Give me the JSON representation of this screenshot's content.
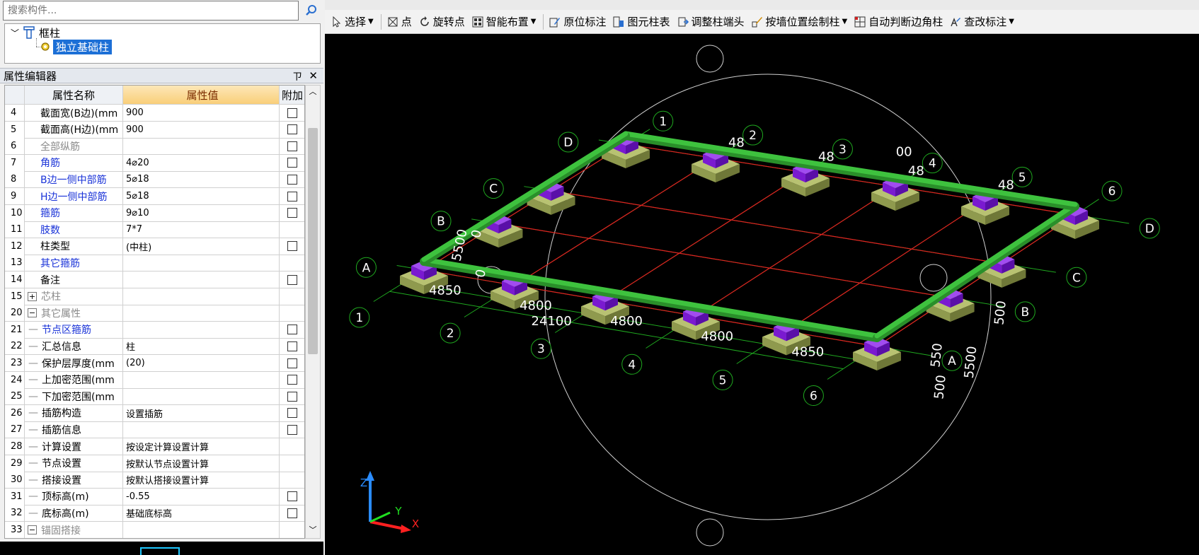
{
  "search": {
    "placeholder": "搜索构件..."
  },
  "tree": {
    "root": "框柱",
    "child": "独立基础柱"
  },
  "panel": {
    "title": "属性编辑器",
    "pin": "ㄗ",
    "close": "✕"
  },
  "grid": {
    "headers": {
      "name": "属性名称",
      "value": "属性值",
      "extra": "附加"
    },
    "rows": [
      {
        "num": "4",
        "name": "截面宽(B边)(mm",
        "value": "900",
        "check": true,
        "color": "black"
      },
      {
        "num": "5",
        "name": "截面高(H边)(mm",
        "value": "900",
        "check": true,
        "color": "black"
      },
      {
        "num": "6",
        "name": "全部纵筋",
        "value": "",
        "check": true,
        "color": "gray"
      },
      {
        "num": "7",
        "name": "角筋",
        "value": "4⌀20",
        "check": true,
        "color": "blue"
      },
      {
        "num": "8",
        "name": "B边一侧中部筋",
        "value": "5⌀18",
        "check": true,
        "color": "blue"
      },
      {
        "num": "9",
        "name": "H边一侧中部筋",
        "value": "5⌀18",
        "check": true,
        "color": "blue"
      },
      {
        "num": "10",
        "name": "箍筋",
        "value": "9⌀10",
        "check": true,
        "color": "blue"
      },
      {
        "num": "11",
        "name": "肢数",
        "value": "7*7",
        "check": false,
        "color": "blue"
      },
      {
        "num": "12",
        "name": "柱类型",
        "value": "(中柱)",
        "check": true,
        "color": "black"
      },
      {
        "num": "13",
        "name": "其它箍筋",
        "value": "",
        "check": false,
        "color": "blue"
      },
      {
        "num": "14",
        "name": "备注",
        "value": "",
        "check": true,
        "color": "black"
      },
      {
        "num": "15",
        "name": "芯柱",
        "value": "",
        "check": false,
        "color": "gray",
        "expander": "+"
      },
      {
        "num": "20",
        "name": "其它属性",
        "value": "",
        "check": false,
        "color": "gray",
        "expander": "−"
      },
      {
        "num": "21",
        "name": "节点区箍筋",
        "value": "",
        "check": true,
        "color": "blue",
        "child": true
      },
      {
        "num": "22",
        "name": "汇总信息",
        "value": "柱",
        "check": true,
        "color": "black",
        "child": true
      },
      {
        "num": "23",
        "name": "保护层厚度(mm",
        "value": "(20)",
        "check": true,
        "color": "black",
        "child": true
      },
      {
        "num": "24",
        "name": "上加密范围(mm",
        "value": "",
        "check": true,
        "color": "black",
        "child": true
      },
      {
        "num": "25",
        "name": "下加密范围(mm",
        "value": "",
        "check": true,
        "color": "black",
        "child": true
      },
      {
        "num": "26",
        "name": "插筋构造",
        "value": "设置插筋",
        "check": true,
        "color": "black",
        "child": true
      },
      {
        "num": "27",
        "name": "插筋信息",
        "value": "",
        "check": true,
        "color": "black",
        "child": true
      },
      {
        "num": "28",
        "name": "计算设置",
        "value": "按设定计算设置计算",
        "check": false,
        "color": "black",
        "child": true
      },
      {
        "num": "29",
        "name": "节点设置",
        "value": "按默认节点设置计算",
        "check": false,
        "color": "black",
        "child": true
      },
      {
        "num": "30",
        "name": "搭接设置",
        "value": "按默认搭接设置计算",
        "check": false,
        "color": "black",
        "child": true
      },
      {
        "num": "31",
        "name": "顶标高(m)",
        "value": "-0.55",
        "check": true,
        "color": "black",
        "child": true
      },
      {
        "num": "32",
        "name": "底标高(m)",
        "value": "基础底标高",
        "check": true,
        "color": "black",
        "child": true
      },
      {
        "num": "33",
        "name": "锚固搭接",
        "value": "",
        "check": false,
        "color": "gray",
        "expander": "−"
      }
    ]
  },
  "toolbar": {
    "items": [
      {
        "label": "选择",
        "icon": "cursor-icon",
        "caret": true
      },
      {
        "label": "点",
        "icon": "point-icon",
        "caret": false
      },
      {
        "label": "旋转点",
        "icon": "rotate-icon",
        "caret": false
      },
      {
        "label": "智能布置",
        "icon": "smart-layout-icon",
        "caret": true
      },
      {
        "label": "原位标注",
        "icon": "annotate-icon",
        "caret": false
      },
      {
        "label": "图元柱表",
        "icon": "column-table-icon",
        "caret": false
      },
      {
        "label": "调整柱端头",
        "icon": "adjust-end-icon",
        "caret": false
      },
      {
        "label": "按墙位置绘制柱",
        "icon": "wall-draw-icon",
        "caret": true
      },
      {
        "label": "自动判断边角柱",
        "icon": "auto-corner-icon",
        "caret": false
      },
      {
        "label": "查改标注",
        "icon": "edit-annotation-icon",
        "caret": true
      }
    ]
  },
  "drawing": {
    "axis_numbers_front": [
      "1",
      "2",
      "3",
      "4",
      "5",
      "6"
    ],
    "axis_numbers_back": [
      "1",
      "2",
      "3",
      "4",
      "5",
      "6"
    ],
    "axis_letters_left": [
      "A",
      "B",
      "C",
      "D"
    ],
    "axis_letters_right": [
      "A",
      "B",
      "C",
      "D"
    ],
    "spans_front": [
      "4850",
      "4800",
      "4800",
      "4800",
      "4850"
    ],
    "total_length": "24100",
    "spans_back_partial": [
      "48",
      "48",
      "48",
      "48"
    ],
    "back_extra": "00",
    "side_dims_right": [
      "500",
      "550",
      "5500",
      "500"
    ],
    "side_dims_left": [
      "5500",
      "0",
      "0"
    ],
    "axis_labels": {
      "x": "X",
      "y": "Y",
      "z": "Z"
    },
    "colors": {
      "beam": "#3ec23e",
      "column": "#7a1ad0",
      "footing": "#8f9a4e",
      "grid_red": "#e02020",
      "grid_green": "#1fa81f"
    }
  }
}
